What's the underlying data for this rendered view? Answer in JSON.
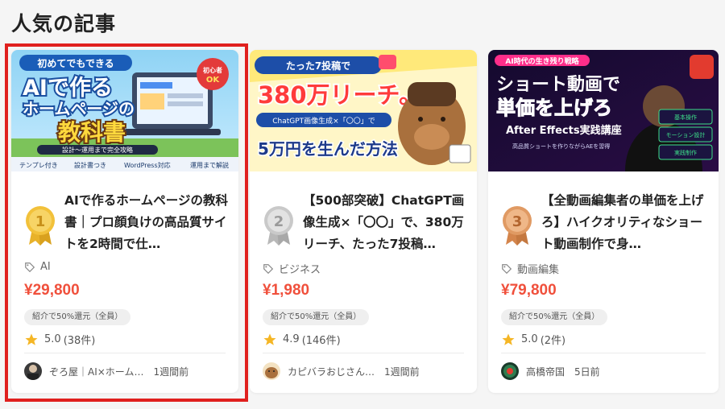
{
  "section": {
    "title": "人気の記事"
  },
  "cards": [
    {
      "rank": "1",
      "title": "AIで作るホームページの教科書｜プロ顔負けの高品質サイトを2時間で仕…",
      "tag": "AI",
      "price": "¥29,800",
      "badge": "紹介で50%還元（全員）",
      "rating": "5.0",
      "reviews": "(38件)",
      "author": "ぞろ屋｜AI×ホーム…",
      "time": "1週間前",
      "thumb": {
        "line1": "初めてでもできる",
        "line2": "AIで作る",
        "line3": "ホームページの",
        "line4": "教科書",
        "sticker": "初心者OK",
        "footer": "設計〜運用まで完全攻略",
        "chip1": "テンプレ付き",
        "chip2": "設計書つき",
        "chip3": "WordPress対応",
        "chip4": "運用まで解説"
      }
    },
    {
      "rank": "2",
      "title": "【500部突破】ChatGPT画像生成×「〇〇」で、380万リーチ、たった7投稿…",
      "tag": "ビジネス",
      "price": "¥1,980",
      "badge": "紹介で50%還元（全員）",
      "rating": "4.9",
      "reviews": "(146件)",
      "author": "カピバラおじさん…",
      "time": "1週間前",
      "thumb": {
        "line1": "たった7投稿で",
        "line2": "380万リーチ。",
        "line3": "ChatGPT画像生成×「〇〇」で",
        "line4": "5万円を生んだ方法"
      }
    },
    {
      "rank": "3",
      "title": "【全動画編集者の単価を上げろ】ハイクオリティなショート動画制作で身…",
      "tag": "動画編集",
      "price": "¥79,800",
      "badge": "紹介で50%還元（全員）",
      "rating": "5.0",
      "reviews": "(2件)",
      "author": "高橋帝国",
      "time": "5日前",
      "thumb": {
        "line1": "AI時代の生き残り戦略",
        "line2": "ショート動画で",
        "line3": "単価を上げろ",
        "line4": "After Effects実践講座",
        "line5": "高品質ショートを作りながらAEを習得",
        "menu1": "基本操作",
        "menu2": "モーション設計",
        "menu3": "実践制作"
      }
    }
  ],
  "colors": {
    "price": "#f0503c",
    "selection": "#e0201e",
    "gold": "#f2c13a",
    "silver": "#c9c9c9",
    "bronze": "#e09a63",
    "star": "#f5b625"
  }
}
